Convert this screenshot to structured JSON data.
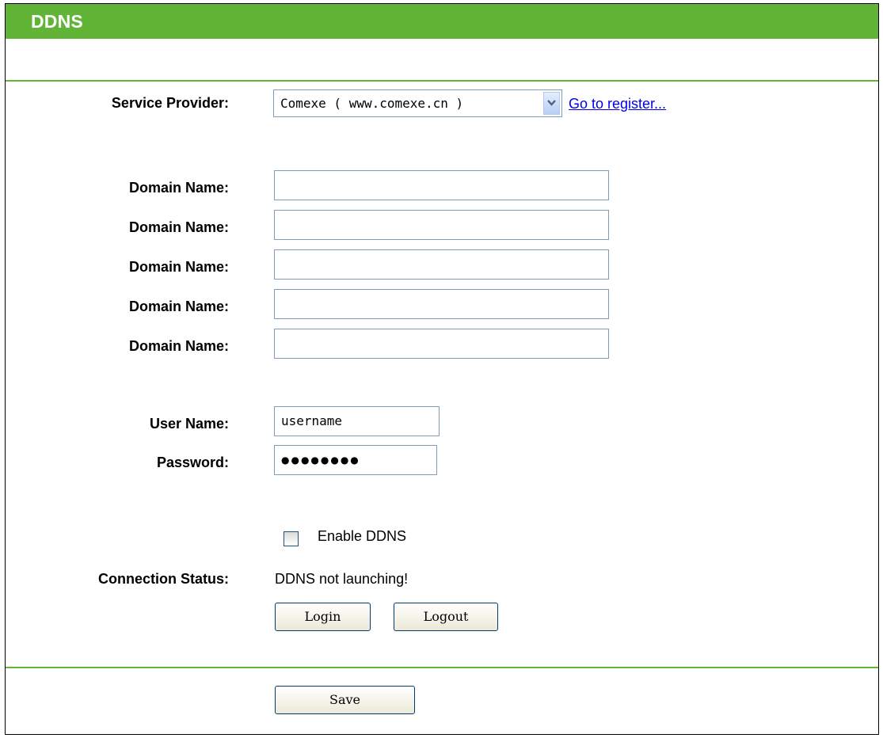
{
  "header": {
    "title": "DDNS"
  },
  "form": {
    "service_provider": {
      "label": "Service Provider:",
      "selected": "Comexe ( www.comexe.cn )",
      "register_link": "Go to register..."
    },
    "domains": [
      {
        "label": "Domain Name:",
        "value": ""
      },
      {
        "label": "Domain Name:",
        "value": ""
      },
      {
        "label": "Domain Name:",
        "value": ""
      },
      {
        "label": "Domain Name:",
        "value": ""
      },
      {
        "label": "Domain Name:",
        "value": ""
      }
    ],
    "username": {
      "label": "User Name:",
      "value": "username"
    },
    "password": {
      "label": "Password:",
      "value": "●●●●●●●●"
    },
    "enable_ddns": {
      "label": "Enable DDNS",
      "checked": false
    },
    "connection_status": {
      "label": "Connection Status:",
      "value": "DDNS not launching!"
    },
    "buttons": {
      "login": "Login",
      "logout": "Logout",
      "save": "Save"
    }
  },
  "colors": {
    "accent": "#62b436",
    "link": "#0000ee"
  }
}
